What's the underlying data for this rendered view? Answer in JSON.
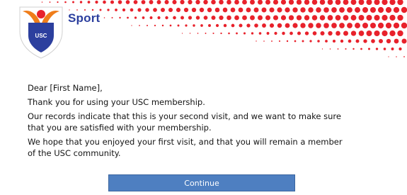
{
  "header": {
    "brand_text": "Sport",
    "logo_text": "USC",
    "pattern_color": "#e8212b",
    "brand_color": "#2c3f9e"
  },
  "letter": {
    "greeting": "Dear [First Name],",
    "thanks": "Thank you for using your USC membership.",
    "records_line1": "Our records indicate that this is your second visit, and we want to make sure",
    "records_line2": "that you are satisfied with your membership.",
    "hope_line1": "We hope that you enjoyed your first visit, and that you will remain a member",
    "hope_line2": "of the USC community."
  },
  "actions": {
    "continue_label": "Continue",
    "continue_color": "#4e7fc1"
  }
}
